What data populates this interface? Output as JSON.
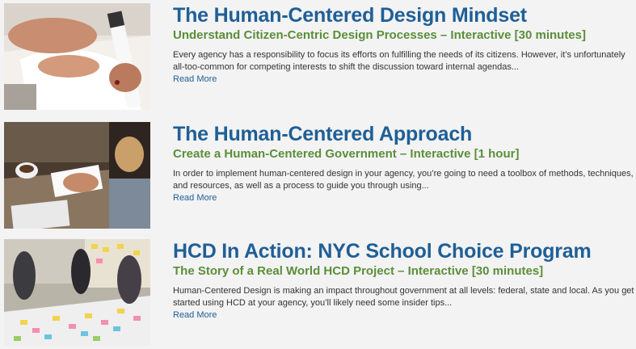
{
  "articles": [
    {
      "title": "The Human-Centered Design Mindset",
      "subtitle": "Understand Citizen-Centric Design Processes – Interactive [30 minutes]",
      "description": "Every agency has a responsibility to focus its efforts on fulfilling the needs of its citizens. However, it’s unfortunately all-too-common for competing interests to shift the discussion toward internal agendas...",
      "read_more": "Read More"
    },
    {
      "title": "The Human-Centered Approach",
      "subtitle": "Create a Human-Centered Government – Interactive [1 hour]",
      "description": "In order to implement human-centered design in your agency, you’re going to need a toolbox of methods, techniques, and resources, as well as a process to guide you through using...",
      "read_more": "Read More"
    },
    {
      "title": "HCD In Action: NYC School Choice Program",
      "subtitle": "The Story of a Real World HCD Project – Interactive [30 minutes]",
      "description": "Human-Centered Design is making an impact throughout government at all levels: federal, state and local. As you get started using HCD at your agency, you’ll likely need some insider tips...",
      "read_more": "Read More"
    }
  ]
}
